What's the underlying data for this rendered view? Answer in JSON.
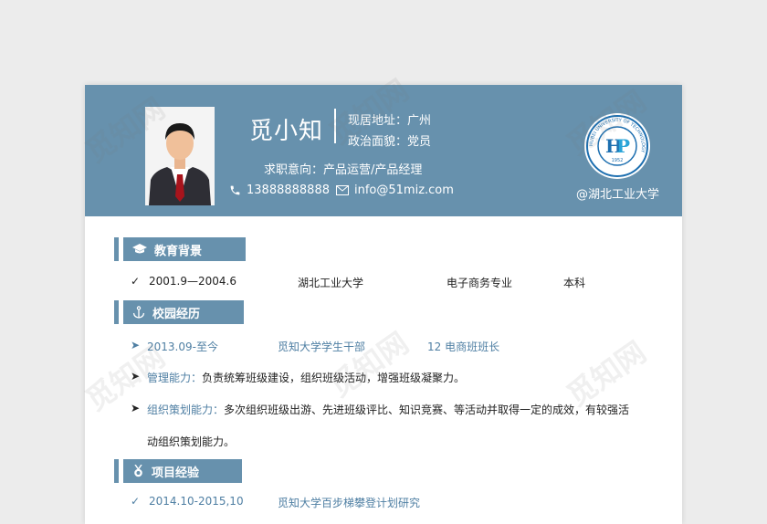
{
  "header": {
    "name": "觅小知",
    "address": "现居地址：广州",
    "political": "政治面貌：党员",
    "intent": "求职意向：产品运营/产品经理",
    "phone": "13888888888",
    "email": "info@51miz.com",
    "school": "@湖北工业大学",
    "logo_arc_text": "湖北工业大学",
    "logo_ring_text": "HUBEI UNIVERSITY OF TECHNOLOGY",
    "logo_year": "1952"
  },
  "education": {
    "title": "教育背景",
    "period": "2001.9—2004.6",
    "school": "湖北工业大学",
    "major": "电子商务专业",
    "degree": "本科"
  },
  "campus": {
    "title": "校园经历",
    "period": "2013.09-至今",
    "org": "觅知大学学生干部",
    "role": "12 电商班班长",
    "item1_label": "管理能力：",
    "item1_text": "负责统筹班级建设，组织班级活动，增强班级凝聚力。",
    "item2_label": "组织策划能力：",
    "item2_text": "多次组织班级出游、先进班级评比、知识竞赛、等活动并取得一定的成效，有较强活",
    "item2_cont": "动组织策划能力。"
  },
  "project": {
    "title": "项目经验",
    "period": "2014.10-2015,10",
    "name": "觅知大学百步梯攀登计划研究"
  },
  "watermark": "觅知网",
  "colors": {
    "accent": "#6791ad",
    "link": "#4f7fa3"
  }
}
